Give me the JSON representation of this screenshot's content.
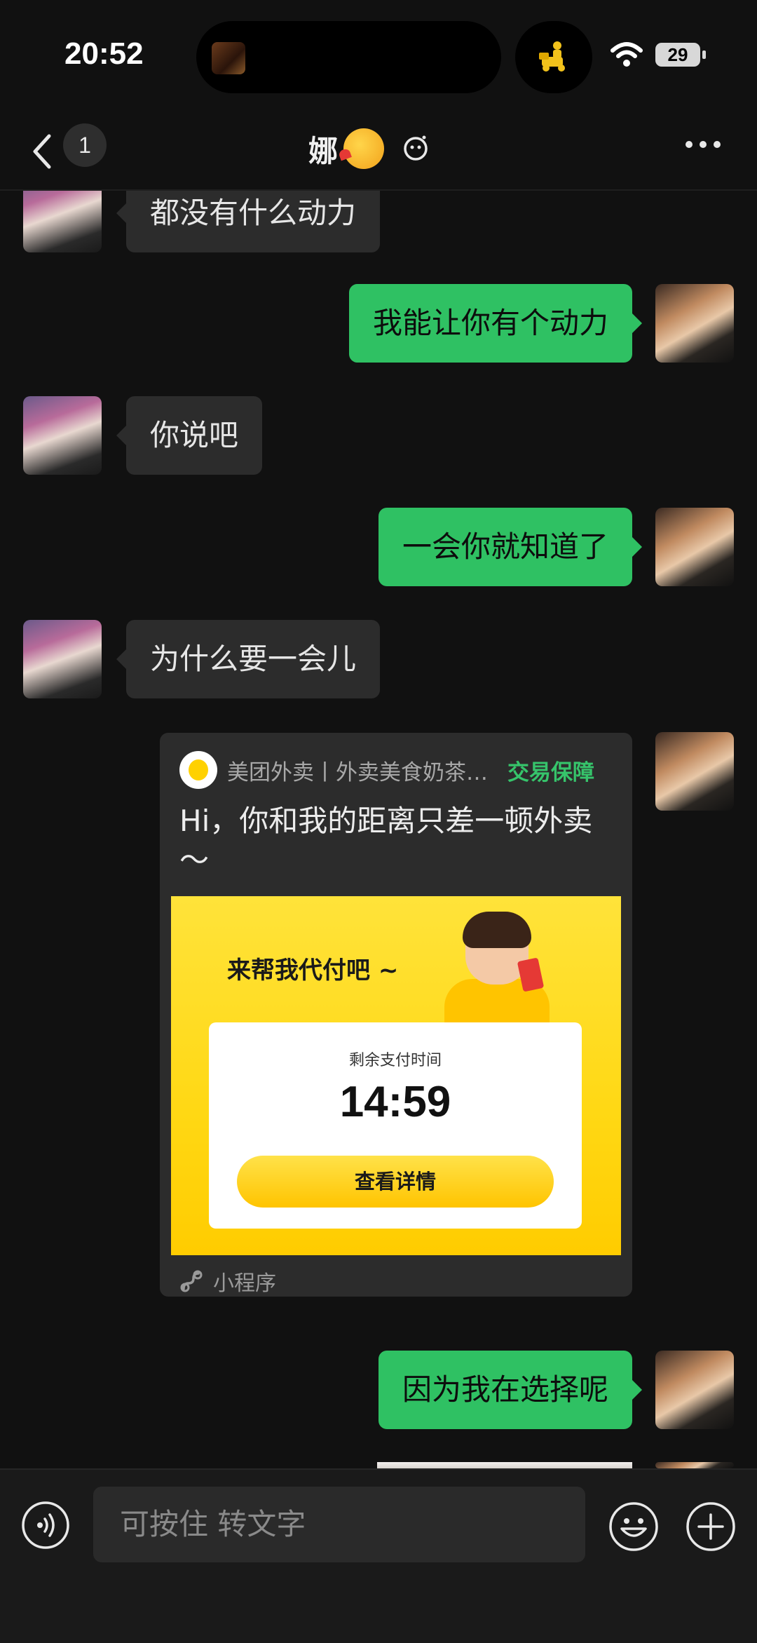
{
  "status_bar": {
    "time": "20:52",
    "battery": "29"
  },
  "nav": {
    "unread_count": "1",
    "title": "娜"
  },
  "messages": [
    {
      "side": "left",
      "text": "都没有什么动力"
    },
    {
      "side": "right",
      "text": "我能让你有个动力"
    },
    {
      "side": "left",
      "text": "你说吧"
    },
    {
      "side": "right",
      "text": "一会你就知道了"
    },
    {
      "side": "left",
      "text": "为什么要一会儿"
    },
    {
      "side": "right",
      "text": "因为我在选择呢"
    }
  ],
  "mini_program_card": {
    "app_name": "美团外卖丨外卖美食奶茶…",
    "guarantee": "交易保障",
    "message": "Hi，你和我的距离只差一顿外卖～",
    "promo_title": "来帮我代付吧 ~",
    "countdown_label": "剩余支付时间",
    "countdown": "14:59",
    "button_label": "查看详情",
    "footer_label": "小程序",
    "colors": {
      "promo_bg": "#ffd814",
      "guarantee": "#36c46b"
    }
  },
  "input_bar": {
    "placeholder": "可按住 转文字"
  },
  "colors": {
    "background": "#111111",
    "bubble_self": "#2fc163",
    "bubble_other": "#2c2c2c"
  }
}
